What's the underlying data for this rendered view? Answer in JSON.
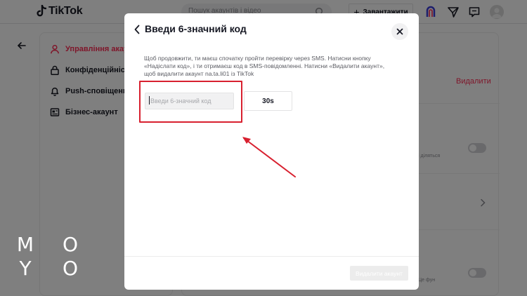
{
  "app": {
    "logo_text": "TikTok",
    "search_placeholder": "Пошук акаунтів і відео",
    "upload_label": "Завантажити"
  },
  "sidebar": {
    "items": [
      {
        "label": "Управління акаунтом",
        "icon": "person-icon",
        "active": true
      },
      {
        "label": "Конфіденційність",
        "icon": "lock-icon",
        "active": false
      },
      {
        "label": "Push-сповіщення",
        "icon": "bell-icon",
        "active": false
      },
      {
        "label": "Бізнес-акаунт",
        "icon": "business-icon",
        "active": false
      }
    ]
  },
  "content": {
    "delete_link": "Видалити",
    "peek_text_1": "і діляться",
    "peek_text_2": "Це фун"
  },
  "modal": {
    "title": "Введи 6-значний код",
    "description": "Щоб продовжити, ти маєш спочатку пройти перевірку через SMS. Натисни кнопку «Надіслати код», і ти отримаєш код в SMS-повідомленні. Натисни «Видалити акаунт», щоб видалити акаунт na.ta.li01 із TikTok",
    "code_placeholder": "Введи 6-значний код",
    "code_value": "",
    "resend_timer": "30s",
    "delete_button": "Видалити акаунт"
  },
  "watermark": {
    "letters": [
      "M",
      "O",
      "Y",
      "O"
    ]
  },
  "colors": {
    "brand_red": "#fe2c55",
    "annotation_red": "#d8202f",
    "overlay": "rgba(0,0,0,0.5)"
  }
}
